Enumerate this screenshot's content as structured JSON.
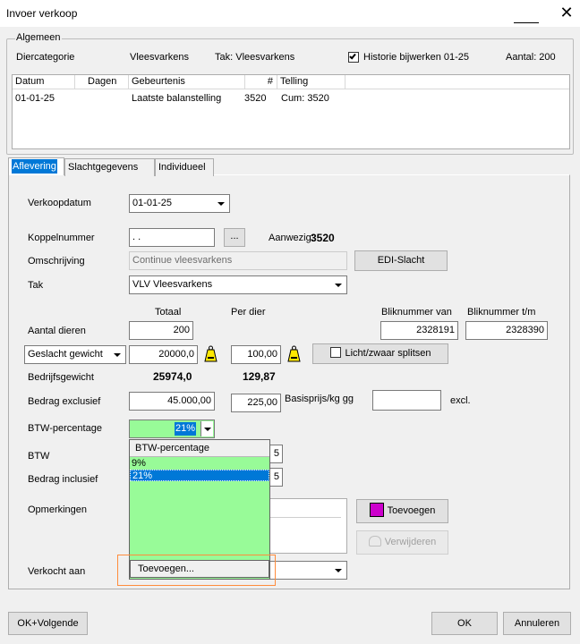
{
  "window": {
    "title": "Invoer verkoop",
    "close": "✕"
  },
  "algemeen": {
    "legend": "Algemeen",
    "diercategorie_label": "Diercategorie",
    "diercategorie_value": "Vleesvarkens",
    "tak_text": "Tak: Vleesvarkens",
    "historie_label": "Historie bijwerken 01-25",
    "historie_checked": true,
    "aantal_text": "Aantal: 200"
  },
  "history_table": {
    "columns": [
      "Datum",
      "Dagen",
      "Gebeurtenis",
      "#",
      "Telling"
    ],
    "rows": [
      {
        "datum": "01-01-25",
        "dagen": "",
        "gebeurtenis": "Laatste balanstelling",
        "nr": "3520",
        "telling": "Cum: 3520"
      }
    ]
  },
  "tabs": [
    {
      "label": "Aflevering",
      "active": true
    },
    {
      "label": "Slachtgegevens",
      "active": false
    },
    {
      "label": "Individueel",
      "active": false
    }
  ],
  "form": {
    "verkoopdatum_label": "Verkoopdatum",
    "verkoopdatum_value": "01-01-25",
    "koppelnummer_label": "Koppelnummer",
    "koppelnummer_value": ". .",
    "browse_label": "...",
    "aanwezig_label": "Aanwezig:",
    "aanwezig_value": "3520",
    "omschrijving_label": "Omschrijving",
    "omschrijving_value": "Continue vleesvarkens",
    "edi_button": "EDI-Slacht",
    "tak_label": "Tak",
    "tak_value": "VLV  Vleesvarkens",
    "totaal_header": "Totaal",
    "per_dier_header": "Per dier",
    "bliknummer_van_header": "Bliknummer van",
    "bliknummer_tm_header": "Bliknummer t/m",
    "aantal_dieren_label": "Aantal dieren",
    "aantal_dieren_value": "200",
    "bliknummer_van_value": "2328191",
    "bliknummer_tm_value": "2328390",
    "gewicht_select": "Geslacht gewicht",
    "gewicht_totaal": "20000,0",
    "gewicht_per_dier": "100,00",
    "licht_zwaar_label": "Licht/zwaar splitsen",
    "bedrijfsgewicht_label": "Bedrijfsgewicht",
    "bedrijfsgewicht_totaal": "25974,0",
    "bedrijfsgewicht_per_dier": "129,87",
    "bedrag_excl_label": "Bedrag exclusief",
    "bedrag_excl_totaal": "45.000,00",
    "bedrag_excl_per_dier": "225,00",
    "basisprijs_label": "Basisprijs/kg gg",
    "basisprijs_value": "",
    "excl_label": "excl.",
    "btw_perc_label": "BTW-percentage",
    "btw_perc_value": "21%",
    "btw_label": "BTW",
    "bedrag_incl_label": "Bedrag inclusief",
    "opmerkingen_label": "Opmerkingen",
    "toevoegen_button": "Toevoegen",
    "verwijderen_button": "Verwijderen",
    "verkocht_aan_label": "Verkocht aan",
    "verkocht_aan_value": "",
    "partial_digit_1": "5",
    "partial_digit_2": "5"
  },
  "dropdown": {
    "header": "BTW-percentage",
    "items": [
      {
        "label": "9%",
        "selected": false
      },
      {
        "label": "21%",
        "selected": true
      }
    ],
    "add_label": "Toevoegen..."
  },
  "footer": {
    "ok_volgende": "OK+Volgende",
    "ok": "OK",
    "annuleren": "Annuleren"
  },
  "colors": {
    "accent": "#0078d7",
    "dropdown_bg": "#98fb98",
    "highlight_border": "#ff8c3c",
    "toevoegen_icon": "#cc00cc"
  }
}
